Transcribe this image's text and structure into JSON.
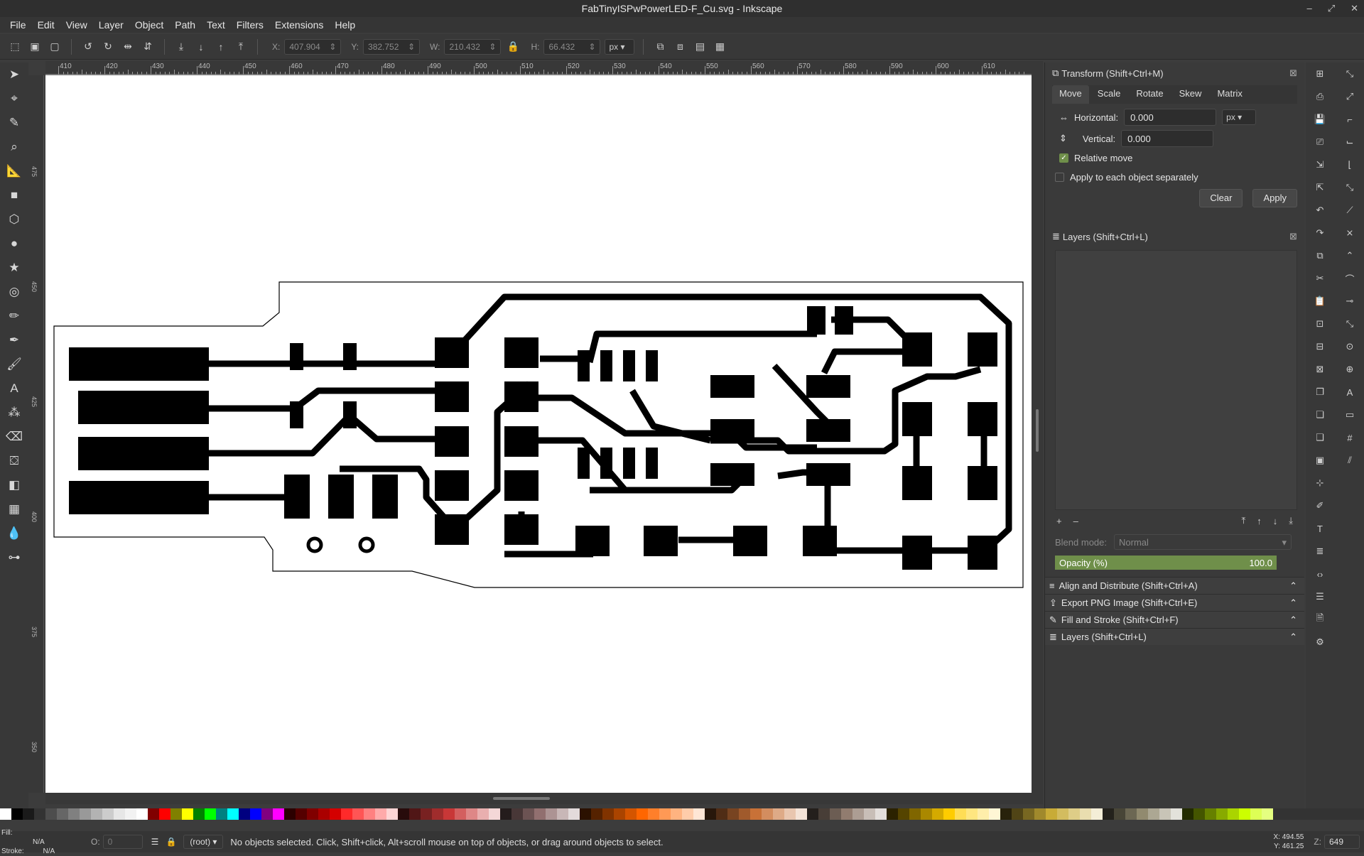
{
  "window": {
    "title": "FabTinyISPwPowerLED-F_Cu.svg - Inkscape"
  },
  "menu": [
    "File",
    "Edit",
    "View",
    "Layer",
    "Object",
    "Path",
    "Text",
    "Filters",
    "Extensions",
    "Help"
  ],
  "toolbar": {
    "x_label": "X:",
    "x_value": "407.904",
    "y_label": "Y:",
    "y_value": "382.752",
    "w_label": "W:",
    "w_value": "210.432",
    "h_label": "H:",
    "h_value": "66.432",
    "unit": "px"
  },
  "ruler_ticks": [
    "410",
    "420",
    "430",
    "440",
    "450",
    "460",
    "470",
    "480",
    "490",
    "500",
    "510",
    "520",
    "530",
    "540",
    "550",
    "560",
    "570",
    "580",
    "590",
    "600",
    "610"
  ],
  "ruler_left_ticks": [
    "475",
    "450",
    "425",
    "400",
    "375",
    "350"
  ],
  "transform": {
    "title": "Transform (Shift+Ctrl+M)",
    "tabs": [
      "Move",
      "Scale",
      "Rotate",
      "Skew",
      "Matrix"
    ],
    "horizontal_label": "Horizontal:",
    "horizontal_value": "0.000",
    "vertical_label": "Vertical:",
    "vertical_value": "0.000",
    "unit": "px",
    "relative_move": "Relative move",
    "apply_each": "Apply to each object separately",
    "clear": "Clear",
    "apply": "Apply"
  },
  "layers": {
    "title": "Layers (Shift+Ctrl+L)",
    "blend_label": "Blend mode:",
    "blend_value": "Normal",
    "opacity_label": "Opacity (%)",
    "opacity_value": "100.0"
  },
  "collapsed_panels": [
    "Align and Distribute (Shift+Ctrl+A)",
    "Export PNG Image (Shift+Ctrl+E)",
    "Fill and Stroke (Shift+Ctrl+F)",
    "Layers (Shift+Ctrl+L)"
  ],
  "status": {
    "fill_label": "Fill:",
    "fill_value": "N/A",
    "stroke_label": "Stroke:",
    "stroke_value": "N/A",
    "opacity_label": "O:",
    "opacity_value": "0",
    "layer": "(root)",
    "message": "No objects selected. Click, Shift+click, Alt+scroll mouse on top of objects, or drag around objects to select.",
    "x_coord": "X: 494.55",
    "y_coord": "Y: 461.25",
    "zoom_label": "Z:",
    "zoom_value": "649"
  },
  "colors": {
    "accent": "#6f8f4a"
  }
}
